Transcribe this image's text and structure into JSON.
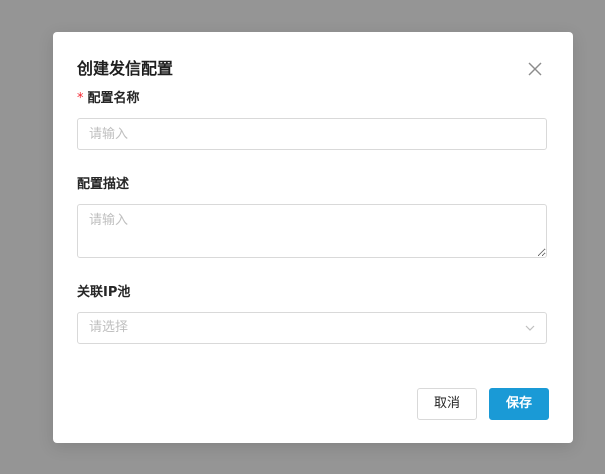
{
  "modal": {
    "title": "创建发信配置"
  },
  "form": {
    "name": {
      "required_mark": "*",
      "label": "配置名称",
      "placeholder": "请输入",
      "value": ""
    },
    "description": {
      "label": "配置描述",
      "placeholder": "请输入",
      "value": ""
    },
    "ip_pool": {
      "label": "关联IP池",
      "placeholder": "请选择"
    }
  },
  "footer": {
    "cancel_label": "取消",
    "save_label": "保存"
  },
  "colors": {
    "primary": "#1a9ad6",
    "required": "#f5222d",
    "backdrop": "#959595"
  },
  "icons": {
    "close": "close-icon",
    "dropdown": "chevron-down-icon"
  }
}
